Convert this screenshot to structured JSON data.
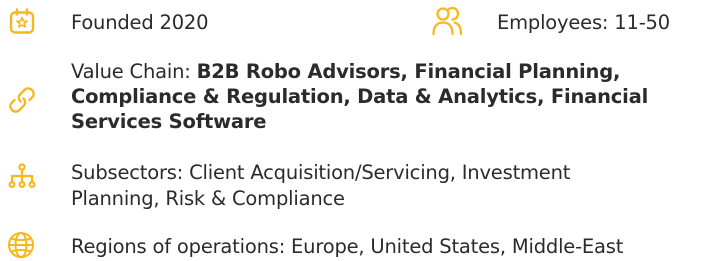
{
  "colors": {
    "accent": "#F6B81C",
    "text": "#2B2B2B"
  },
  "founded": {
    "icon": "calendar-star-icon",
    "text": "Founded 2020"
  },
  "employees": {
    "icon": "people-icon",
    "text": "Employees: 11-50"
  },
  "value_chain": {
    "icon": "link-icon",
    "label": "Value Chain: ",
    "line1": "B2B Robo Advisors, Financial Planning,",
    "line2": "Compliance & Regulation, Data & Analytics, Financial",
    "line3": "Services Software"
  },
  "subsectors": {
    "icon": "org-chart-icon",
    "line1": "Subsectors: Client Acquisition/Servicing, Investment",
    "line2": "Planning, Risk & Compliance"
  },
  "regions": {
    "icon": "globe-icon",
    "text": "Regions of operations: Europe, United States, Middle-East"
  }
}
